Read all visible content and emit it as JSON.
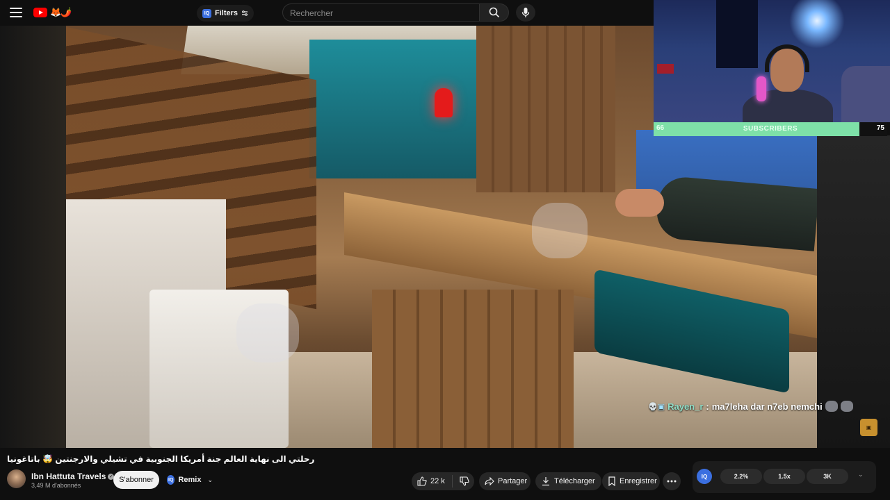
{
  "header": {
    "filters_label": "Filters",
    "filters_badge": "IQ",
    "search_placeholder": "Rechercher"
  },
  "overlay": {
    "subscribers": {
      "label": "SUBSCRIBERS",
      "current": "66",
      "goal": "75",
      "progress_fraction": 0.88,
      "bar_color": "#7ee0a8"
    },
    "chat": {
      "username": "Rayen_r",
      "separator": ":",
      "message": "ma7leha dar n7eb nemchi"
    }
  },
  "video": {
    "title": "رحلتي الى نهاية العالم جنة أمريكا الجنوبية في تشيلي والارجنتين 🤯 باتاغونيا",
    "channel_name": "Ibn Hattuta Travels",
    "channel_subscribers": "3,49 M d'abonnés"
  },
  "actions": {
    "subscribe_label": "S'abonner",
    "remix_label": "Remix",
    "like_count": "22 k",
    "share_label": "Partager",
    "download_label": "Télécharger",
    "save_label": "Enregistrer"
  },
  "extension_panel": {
    "logo": "IQ",
    "chips": [
      "2.2%",
      "1.5x",
      "3K"
    ]
  },
  "colors": {
    "brand_red": "#ff0000",
    "accent_blue": "#3b6fe0"
  }
}
